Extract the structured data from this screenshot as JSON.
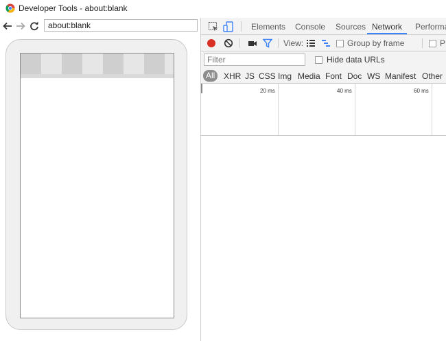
{
  "window": {
    "title": "Developer Tools - about:blank",
    "app_icon": "chrome-icon"
  },
  "browser": {
    "url": "about:blank",
    "nav_icons": [
      "back-arrow-icon",
      "forward-arrow-icon",
      "reload-icon"
    ]
  },
  "devtools": {
    "toolbar_icons": [
      "inspect-element-icon",
      "device-toggle-icon"
    ],
    "tabs": [
      {
        "label": "Elements"
      },
      {
        "label": "Console"
      },
      {
        "label": "Sources"
      },
      {
        "label": "Network",
        "active": true
      },
      {
        "label": "Performa"
      }
    ],
    "network_toolbar": {
      "record_icon": "record-icon",
      "clear_icon": "clear-icon",
      "screenshot_icon": "video-camera-icon",
      "filter_icon": "filter-funnel-icon",
      "view_label": "View:",
      "view_icons": [
        "large-rows-icon",
        "waterfall-icon"
      ],
      "group_by_frame_label": "Group by frame",
      "preserve_log_label": "P"
    },
    "filter": {
      "placeholder": "Filter",
      "hide_data_urls_label": "Hide data URLs"
    },
    "resource_types": [
      "All",
      "XHR",
      "JS",
      "CSS",
      "Img",
      "Media",
      "Font",
      "Doc",
      "WS",
      "Manifest",
      "Other"
    ],
    "timeline_ticks": [
      "20 ms",
      "40 ms",
      "60 ms"
    ],
    "accent_color": "#3e82f7",
    "record_color": "#d93025"
  }
}
